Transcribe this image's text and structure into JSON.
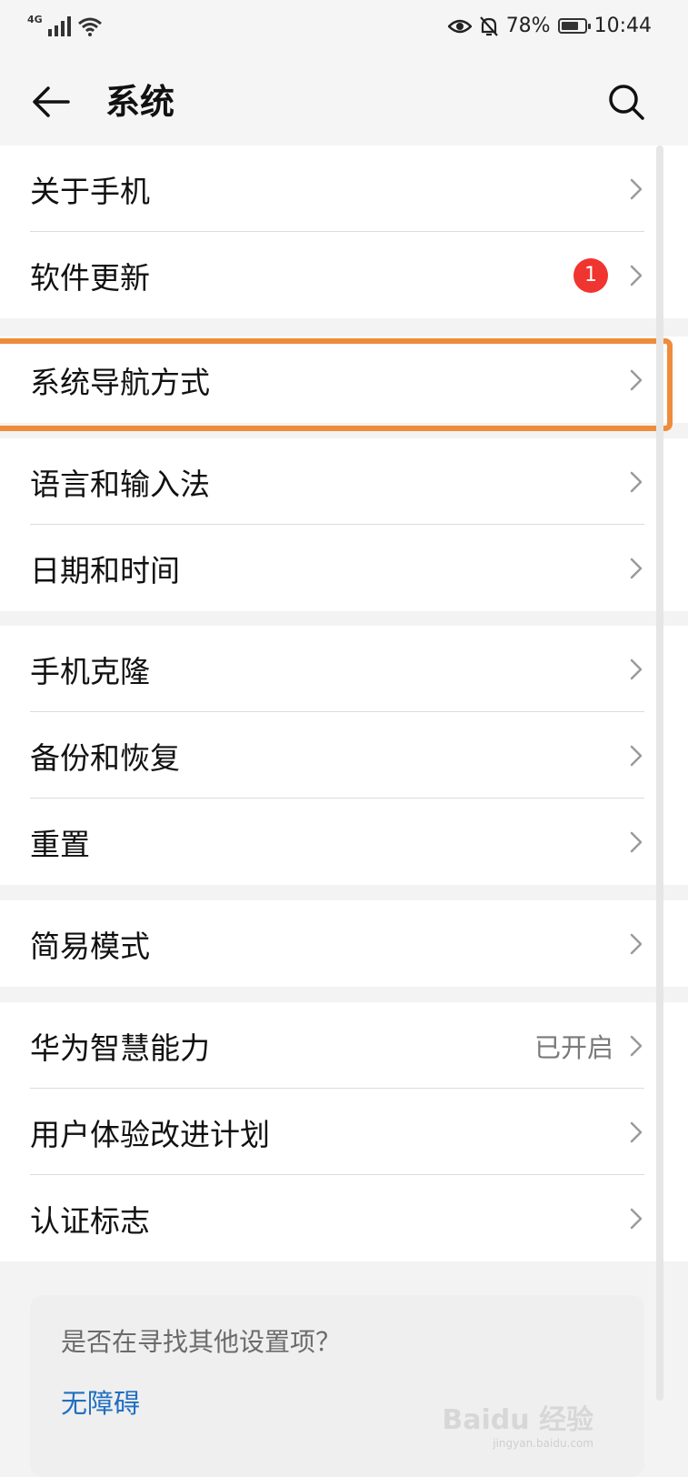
{
  "status_bar": {
    "network": "4G",
    "battery": "78%",
    "battery_level": 0.78,
    "time": "10:44"
  },
  "app_bar": {
    "title": "系统"
  },
  "groups": [
    {
      "items": [
        {
          "label": "关于手机"
        },
        {
          "label": "软件更新",
          "badge": "1"
        }
      ]
    },
    {
      "items": [
        {
          "label": "系统导航方式"
        }
      ]
    },
    {
      "items": [
        {
          "label": "语言和输入法"
        },
        {
          "label": "日期和时间"
        }
      ]
    },
    {
      "items": [
        {
          "label": "手机克隆"
        },
        {
          "label": "备份和恢复"
        },
        {
          "label": "重置"
        }
      ]
    },
    {
      "items": [
        {
          "label": "简易模式"
        }
      ]
    },
    {
      "items": [
        {
          "label": "华为智慧能力",
          "value": "已开启"
        },
        {
          "label": "用户体验改进计划"
        },
        {
          "label": "认证标志"
        }
      ]
    }
  ],
  "suggest": {
    "question": "是否在寻找其他设置项？",
    "link": "无障碍"
  },
  "watermark": {
    "text": "Baidu 经验",
    "sub": "jingyan.baidu.com"
  },
  "colors": {
    "highlight": "#ef8c3c",
    "badge": "#f0342f",
    "link": "#1f6fc2"
  }
}
